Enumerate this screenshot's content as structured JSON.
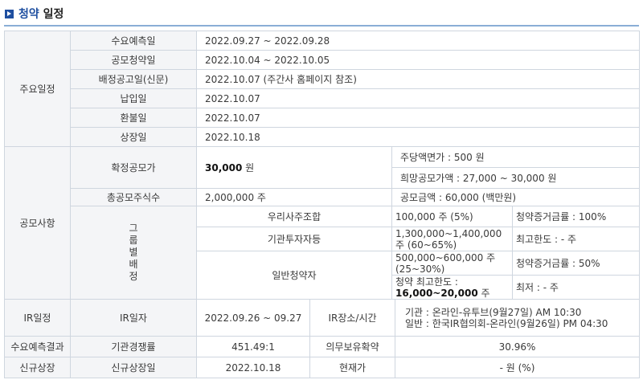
{
  "header": {
    "title_blue": "청약",
    "title_black": "일정"
  },
  "main_schedule": {
    "label": "주요일정",
    "rows": [
      {
        "label": "수요예측일",
        "value": "2022.09.27  ~  2022.09.28"
      },
      {
        "label": "공모청약일",
        "value": "2022.10.04  ~  2022.10.05"
      },
      {
        "label": "배정공고일(신문)",
        "value": "2022.10.07 (주간사 홈페이지 참조)"
      },
      {
        "label": "납입일",
        "value": "2022.10.07"
      },
      {
        "label": "환불일",
        "value": "2022.10.07"
      },
      {
        "label": "상장일",
        "value": "2022.10.18"
      }
    ]
  },
  "offering": {
    "label": "공모사항",
    "final_price_label": "확정공모가",
    "final_price_value": "30,000",
    "final_price_unit": "원",
    "par_value": "주당액면가 :  500 원",
    "desired_price": "희망공모가액 :  27,000 ~ 30,000 원",
    "total_shares_label": "총공모주식수",
    "total_shares_value": "2,000,000 주",
    "total_amount": "공모금액 : 60,000 (백만원)",
    "group_label": "그룹별배정",
    "employee_label": "우리사주조합",
    "employee_shares": "100,000 주  (5%)",
    "employee_deposit": "청약증거금률 : 100%",
    "inst_label": "기관투자자등",
    "inst_shares": "1,300,000~1,400,000 주 (60~65%)",
    "inst_limit": "최고한도 :  - 주",
    "retail_label": "일반청약자",
    "retail_shares": "500,000~600,000 주 (25~30%)",
    "retail_deposit": "청약증거금률 : 50%",
    "retail_max_label": "청약 최고한도 :",
    "retail_max_value": "16,000~20,000",
    "retail_max_unit": "주",
    "retail_min": "최저 :  - 주"
  },
  "ir": {
    "label": "IR일정",
    "date_label": "IR일자",
    "date_value": "2022.09.26 ~ 09.27",
    "place_label": "IR장소/시간",
    "place_line1": "기관 : 온라인-유투브(9월27일) AM 10:30",
    "place_line2": "일반 : 한국IR협의회-온라인(9월26일) PM 04:30"
  },
  "demand": {
    "label": "수요예측결과",
    "comp_label": "기관경쟁률",
    "comp_value": "451.49:1",
    "lock_label": "의무보유확약",
    "lock_value": "30.96%"
  },
  "listing": {
    "label": "신규상장",
    "date_label": "신규상장일",
    "date_value": "2022.10.18",
    "price_label": "현재가",
    "price_value": "- 원 (%)"
  },
  "colors": {
    "accent": "#1f4fa0",
    "rule": "#8aaed6",
    "label_bg": "#f4f5f7",
    "border": "#cfd6df"
  }
}
